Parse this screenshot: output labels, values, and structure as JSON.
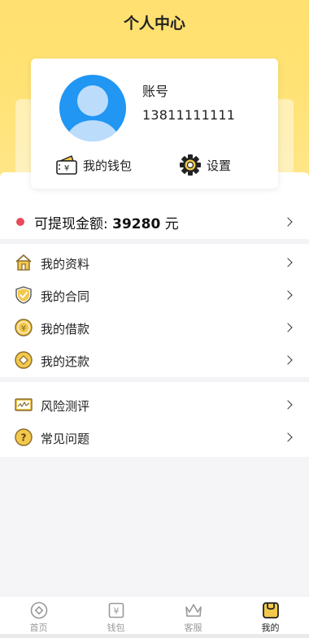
{
  "header": {
    "title": "个人中心"
  },
  "profile": {
    "account_label": "账号",
    "account_value": "13811111111",
    "wallet_label": "我的钱包",
    "settings_label": "设置"
  },
  "withdraw": {
    "label": "可提现金额: ",
    "amount": "39280",
    "unit": " 元"
  },
  "menu_group_1": [
    {
      "label": "我的资料",
      "icon": "house-icon"
    },
    {
      "label": "我的合同",
      "icon": "shield-check-icon"
    },
    {
      "label": "我的借款",
      "icon": "yen-coin-icon"
    },
    {
      "label": "我的还款",
      "icon": "coin-icon"
    }
  ],
  "menu_group_2": [
    {
      "label": "风险测评",
      "icon": "chart-card-icon"
    },
    {
      "label": "常见问题",
      "icon": "question-icon"
    }
  ],
  "tabbar": {
    "items": [
      {
        "label": "首页",
        "icon": "home-circle-icon",
        "active": false
      },
      {
        "label": "钱包",
        "icon": "yen-wallet-icon",
        "active": false
      },
      {
        "label": "客服",
        "icon": "crown-icon",
        "active": false
      },
      {
        "label": "我的",
        "icon": "profile-card-icon",
        "active": true
      }
    ]
  },
  "colors": {
    "accent_yellow": "#ffe070",
    "avatar_blue": "#2196f3",
    "dot_red": "#e94b5b"
  }
}
